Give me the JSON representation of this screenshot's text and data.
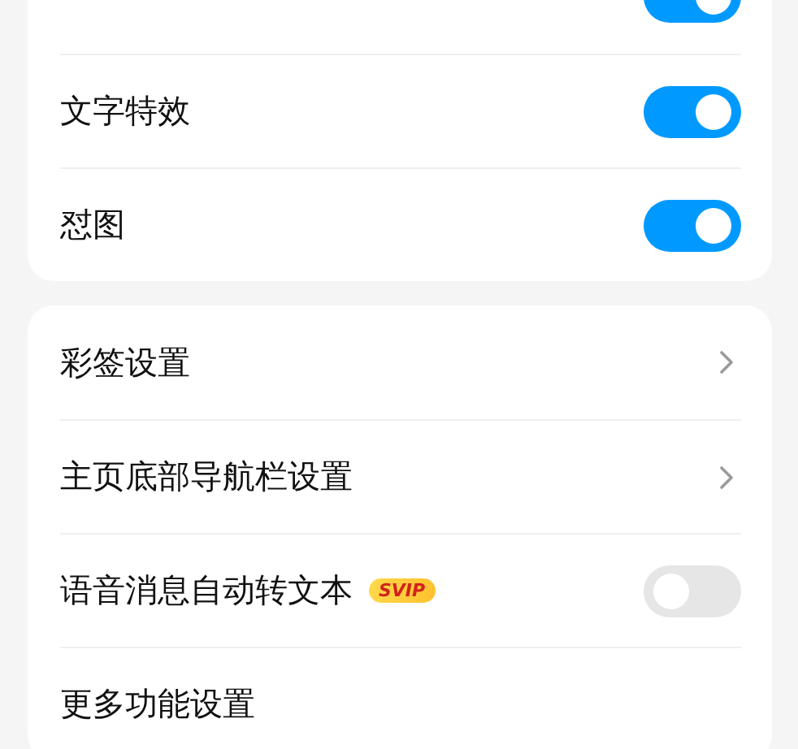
{
  "groups": [
    {
      "rows": [
        {
          "kind": "toggle",
          "on": true
        },
        {
          "kind": "toggle",
          "label": "文字特效",
          "on": true
        },
        {
          "kind": "toggle",
          "label": "怼图",
          "on": true
        }
      ]
    },
    {
      "rows": [
        {
          "kind": "link",
          "label": "彩签设置"
        },
        {
          "kind": "link",
          "label": "主页底部导航栏设置"
        },
        {
          "kind": "toggle",
          "label": "语音消息自动转文本",
          "badge": "SVIP",
          "on": false
        },
        {
          "kind": "plain",
          "label": "更多功能设置"
        }
      ]
    }
  ]
}
